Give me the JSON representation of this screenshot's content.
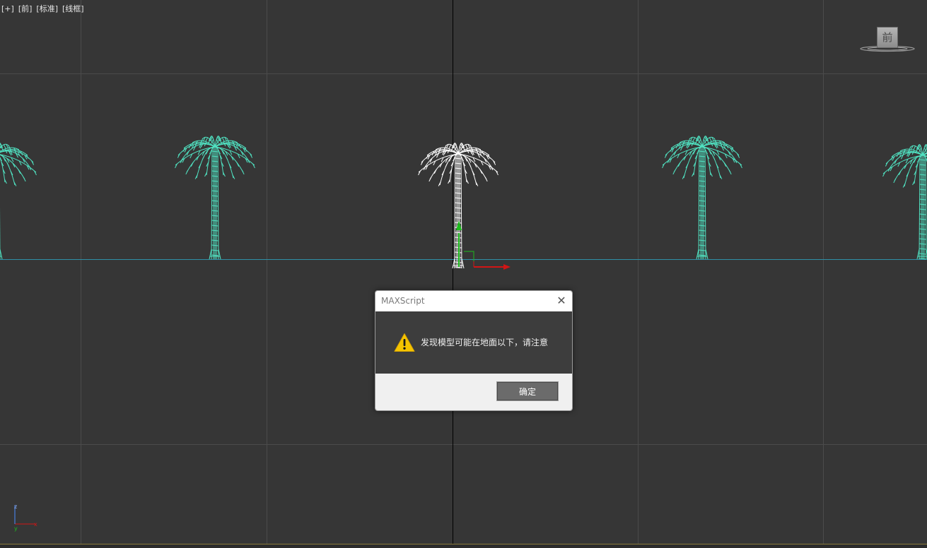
{
  "viewport": {
    "menu": [
      "[+]",
      "[前]",
      "[标准]",
      "[线框]"
    ],
    "viewcube_label": "前",
    "axis_labels": {
      "x": "x",
      "y": "y",
      "z": "z"
    }
  },
  "colors": {
    "background": "#363636",
    "grid": "#4b4b4b",
    "world_axis": "#000000",
    "ground_line": "#2f8fa6",
    "tree_unselected": "#50e3c2",
    "tree_selected": "#ffffff",
    "gizmo_x": "#d11515",
    "gizmo_y": "#1dbb1d"
  },
  "dialog": {
    "title": "MAXScript",
    "close_icon": "close-icon",
    "icon": "warning-icon",
    "message": "发现模型可能在地面以下，请注意",
    "ok_label": "确定"
  }
}
